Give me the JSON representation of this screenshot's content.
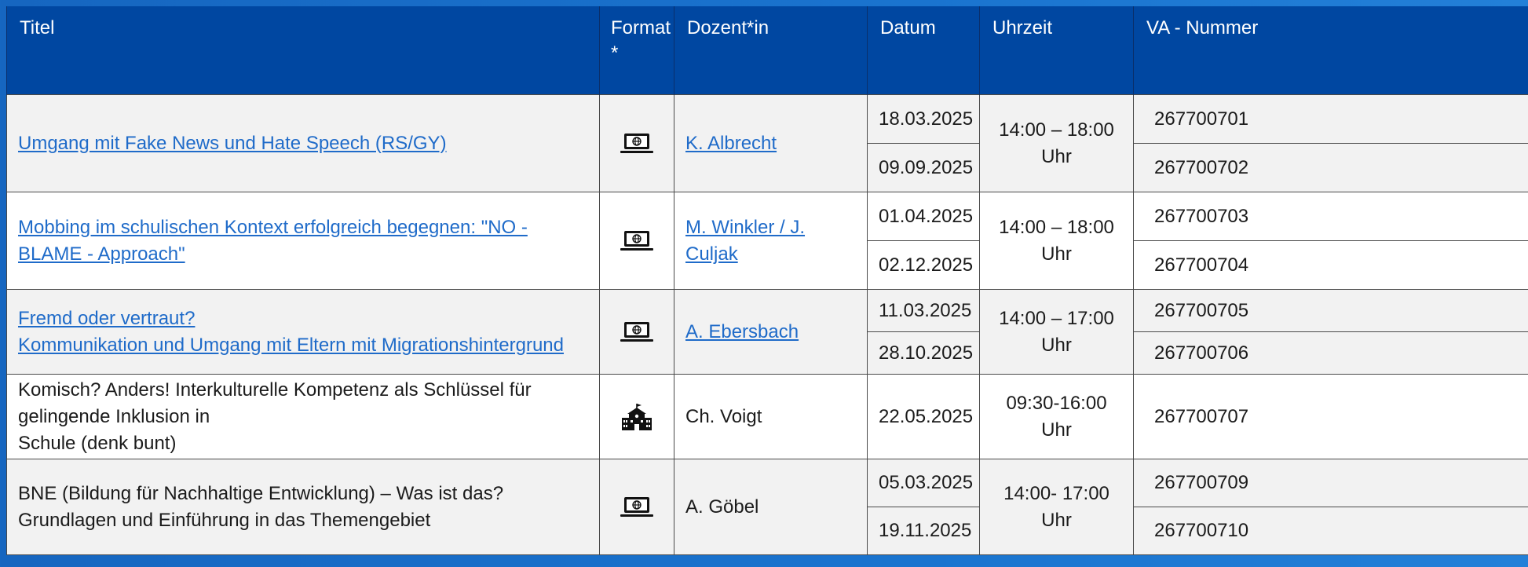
{
  "header": {
    "titel": "Titel",
    "format": "Format *",
    "dozent": "Dozent*in",
    "datum": "Datum",
    "uhrzeit": "Uhrzeit",
    "va": "VA - Nummer"
  },
  "rows": [
    {
      "title_lines": [
        "Umgang mit Fake News und Hate Speech (RS/GY)"
      ],
      "title_link": true,
      "format_icon": "laptop-globe-icon",
      "dozent": "K. Albrecht",
      "dozent_link": true,
      "dates": [
        "18.03.2025",
        "09.09.2025"
      ],
      "time": "14:00 – 18:00 Uhr",
      "va": [
        "267700701",
        "267700702"
      ]
    },
    {
      "title_lines": [
        "Mobbing im schulischen Kontext erfolgreich begegnen: \"NO - BLAME - Approach\""
      ],
      "title_link": true,
      "format_icon": "laptop-globe-icon",
      "dozent": "M. Winkler / J. Culjak",
      "dozent_link": true,
      "dates": [
        "01.04.2025",
        "02.12.2025"
      ],
      "time": "14:00 – 18:00 Uhr",
      "va": [
        "267700703",
        "267700704"
      ]
    },
    {
      "title_lines": [
        "Fremd oder vertraut?",
        "Kommunikation und Umgang mit Eltern mit Migrationshintergrund"
      ],
      "title_link": true,
      "format_icon": "laptop-globe-icon",
      "dozent": "A. Ebersbach",
      "dozent_link": true,
      "dates": [
        "11.03.2025",
        "28.10.2025"
      ],
      "time": "14:00 – 17:00 Uhr",
      "va": [
        "267700705",
        "267700706"
      ]
    },
    {
      "title_lines": [
        "Komisch? Anders! Interkulturelle Kompetenz als Schlüssel für gelingende Inklusion in",
        "Schule (denk bunt)"
      ],
      "title_link": false,
      "format_icon": "school-building-icon",
      "dozent": "Ch. Voigt",
      "dozent_link": false,
      "dates": [
        "22.05.2025"
      ],
      "time": "09:30-16:00 Uhr",
      "va": [
        "267700707"
      ]
    },
    {
      "title_lines": [
        "BNE (Bildung für Nachhaltige Entwicklung) – Was ist das?",
        "Grundlagen und Einführung in das Themengebiet"
      ],
      "title_link": false,
      "format_icon": "laptop-globe-icon",
      "dozent": "A. Göbel",
      "dozent_link": false,
      "dates": [
        "05.03.2025",
        "19.11.2025"
      ],
      "time": "14:00- 17:00 Uhr",
      "va": [
        "267700709",
        "267700710"
      ]
    }
  ],
  "colors": {
    "header_bg": "#0047a1",
    "link": "#1f6bc9",
    "row_grey": "#f2f2f2",
    "row_white": "#ffffff"
  }
}
